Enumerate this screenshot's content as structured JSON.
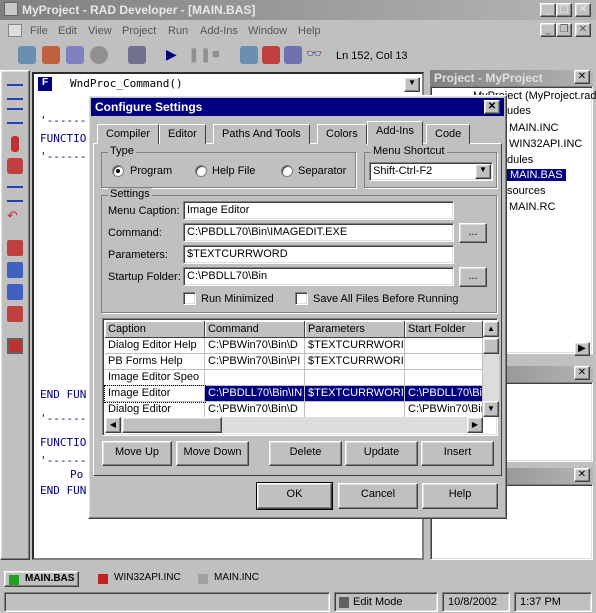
{
  "app": {
    "title": "MyProject - RAD Developer - [MAIN.BAS]",
    "min": "_",
    "max": "□",
    "close": "✕"
  },
  "menu": [
    "File",
    "Edit",
    "View",
    "Project",
    "Run",
    "Add-Ins",
    "Window",
    "Help"
  ],
  "toolbar": {
    "position": "Ln 152, Col 13"
  },
  "editor": {
    "function_dropdown": "WndProc_Command()",
    "lines": [
      "'------",
      "FUNCTIO",
      "'------",
      "END FUN",
      "'------",
      "FUNCTIO",
      "'------",
      "Po",
      "END FUN"
    ]
  },
  "project_panel": {
    "title": "Project - MyProject",
    "items": [
      "MyProject (MyProject.rad",
      "udes",
      "MAIN.INC",
      "WIN32API.INC",
      "dules",
      "MAIN.BAS",
      "sources",
      "MAIN.RC"
    ]
  },
  "dialog": {
    "title": "Configure Settings",
    "tabs": [
      "Compiler",
      "Editor",
      "Paths And Tools",
      "Colors",
      "Add-Ins",
      "Code"
    ],
    "type_group": "Type",
    "type_options": [
      "Program",
      "Help File",
      "Separator"
    ],
    "shortcut_group": "Menu Shortcut",
    "shortcut_value": "Shift-Ctrl-F2",
    "settings_group": "Settings",
    "labels": {
      "caption": "Menu Caption:",
      "command": "Command:",
      "parameters": "Parameters:",
      "startup": "Startup Folder:"
    },
    "values": {
      "caption": "Image Editor",
      "command": "C:\\PBDLL70\\Bin\\IMAGEDIT.EXE",
      "parameters": "$TEXTCURRWORD",
      "startup": "C:\\PBDLL70\\Bin"
    },
    "browse": "...",
    "checks": {
      "minimized": "Run Minimized",
      "save_all": "Save All Files Before Running"
    },
    "columns": [
      "Caption",
      "Command",
      "Parameters",
      "Start Folder"
    ],
    "rows": [
      [
        "Dialog Editor Help",
        "C:\\PBWin70\\Bin\\D",
        "$TEXTCURRWORI",
        ""
      ],
      [
        "PB Forms Help",
        "C:\\PBWin70\\Bin\\PI",
        "$TEXTCURRWORI",
        ""
      ],
      [
        "Image Editor Speo",
        "",
        "",
        ""
      ],
      [
        "Image Editor",
        "C:\\PBDLL70\\Bin\\IN",
        "$TEXTCURRWORI",
        "C:\\PBDLL70\\Bin"
      ],
      [
        "Dialog Editor",
        "C:\\PBWin70\\Bin\\D",
        "",
        "C:\\PBWin70\\Bin"
      ]
    ],
    "buttons": [
      "Move Up",
      "Move Down",
      "Delete",
      "Update",
      "Insert"
    ],
    "ok": "OK",
    "cancel": "Cancel",
    "help": "Help"
  },
  "status": {
    "tabs": [
      "MAIN.BAS",
      "WIN32API.INC",
      "MAIN.INC"
    ],
    "mode": "Edit Mode",
    "date": "10/8/2002",
    "time": "1:37 PM"
  }
}
